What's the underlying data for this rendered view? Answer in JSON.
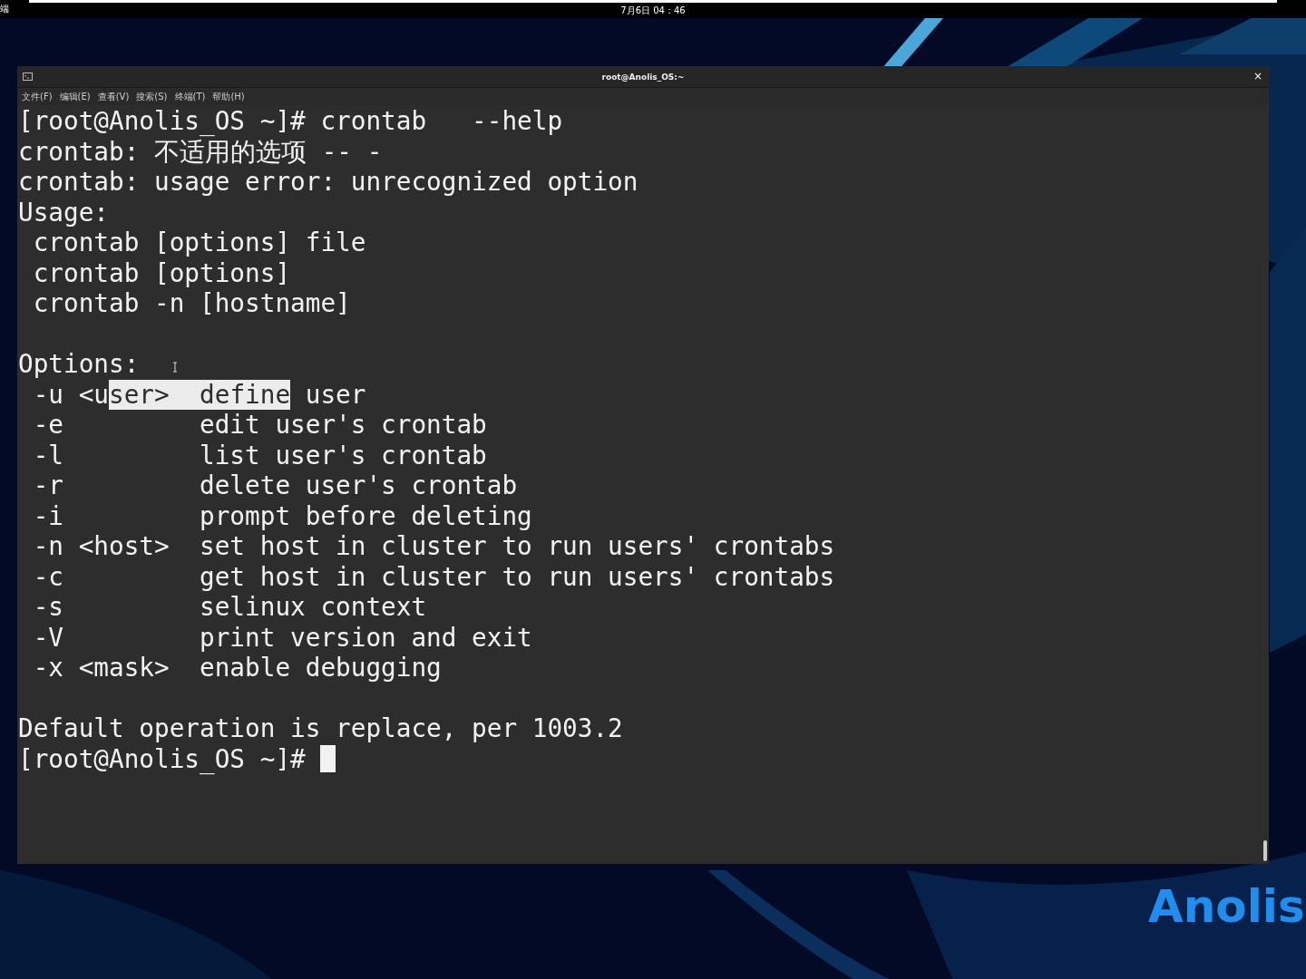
{
  "top_bar": {
    "app_label": "端",
    "clock": "7月6日 04：46"
  },
  "desktop": {
    "logo_text": "Anolis"
  },
  "window": {
    "title": "root@Anolis_OS:~",
    "close": "×"
  },
  "menu": [
    {
      "label": "文件(F)"
    },
    {
      "label": "编辑(E)"
    },
    {
      "label": "查看(V)"
    },
    {
      "label": "搜索(S)"
    },
    {
      "label": "终端(T)"
    },
    {
      "label": "帮助(H)"
    }
  ],
  "terminal": {
    "lines": [
      {
        "kind": "text",
        "text": "[root@Anolis_OS ~]# crontab   --help"
      },
      {
        "kind": "text",
        "text": "crontab: 不适用的选项 -- -"
      },
      {
        "kind": "text",
        "text": "crontab: usage error: unrecognized option"
      },
      {
        "kind": "text",
        "text": "Usage:"
      },
      {
        "kind": "text",
        "text": " crontab [options] file"
      },
      {
        "kind": "text",
        "text": " crontab [options]"
      },
      {
        "kind": "text",
        "text": " crontab -n [hostname]"
      },
      {
        "kind": "blank"
      },
      {
        "kind": "text",
        "text": "Options:"
      },
      {
        "kind": "parts",
        "parts": [
          {
            "text": " -u <u",
            "selected": false
          },
          {
            "text": "ser>  define",
            "selected": true
          },
          {
            "text": " user",
            "selected": false
          }
        ]
      },
      {
        "kind": "text",
        "text": " -e         edit user's crontab"
      },
      {
        "kind": "text",
        "text": " -l         list user's crontab"
      },
      {
        "kind": "text",
        "text": " -r         delete user's crontab"
      },
      {
        "kind": "text",
        "text": " -i         prompt before deleting"
      },
      {
        "kind": "text",
        "text": " -n <host>  set host in cluster to run users' crontabs"
      },
      {
        "kind": "text",
        "text": " -c         get host in cluster to run users' crontabs"
      },
      {
        "kind": "text",
        "text": " -s         selinux context"
      },
      {
        "kind": "text",
        "text": " -V         print version and exit"
      },
      {
        "kind": "text",
        "text": " -x <mask>  enable debugging"
      },
      {
        "kind": "blank"
      },
      {
        "kind": "text",
        "text": "Default operation is replace, per 1003.2"
      },
      {
        "kind": "prompt",
        "text": "[root@Anolis_OS ~]# "
      }
    ]
  }
}
